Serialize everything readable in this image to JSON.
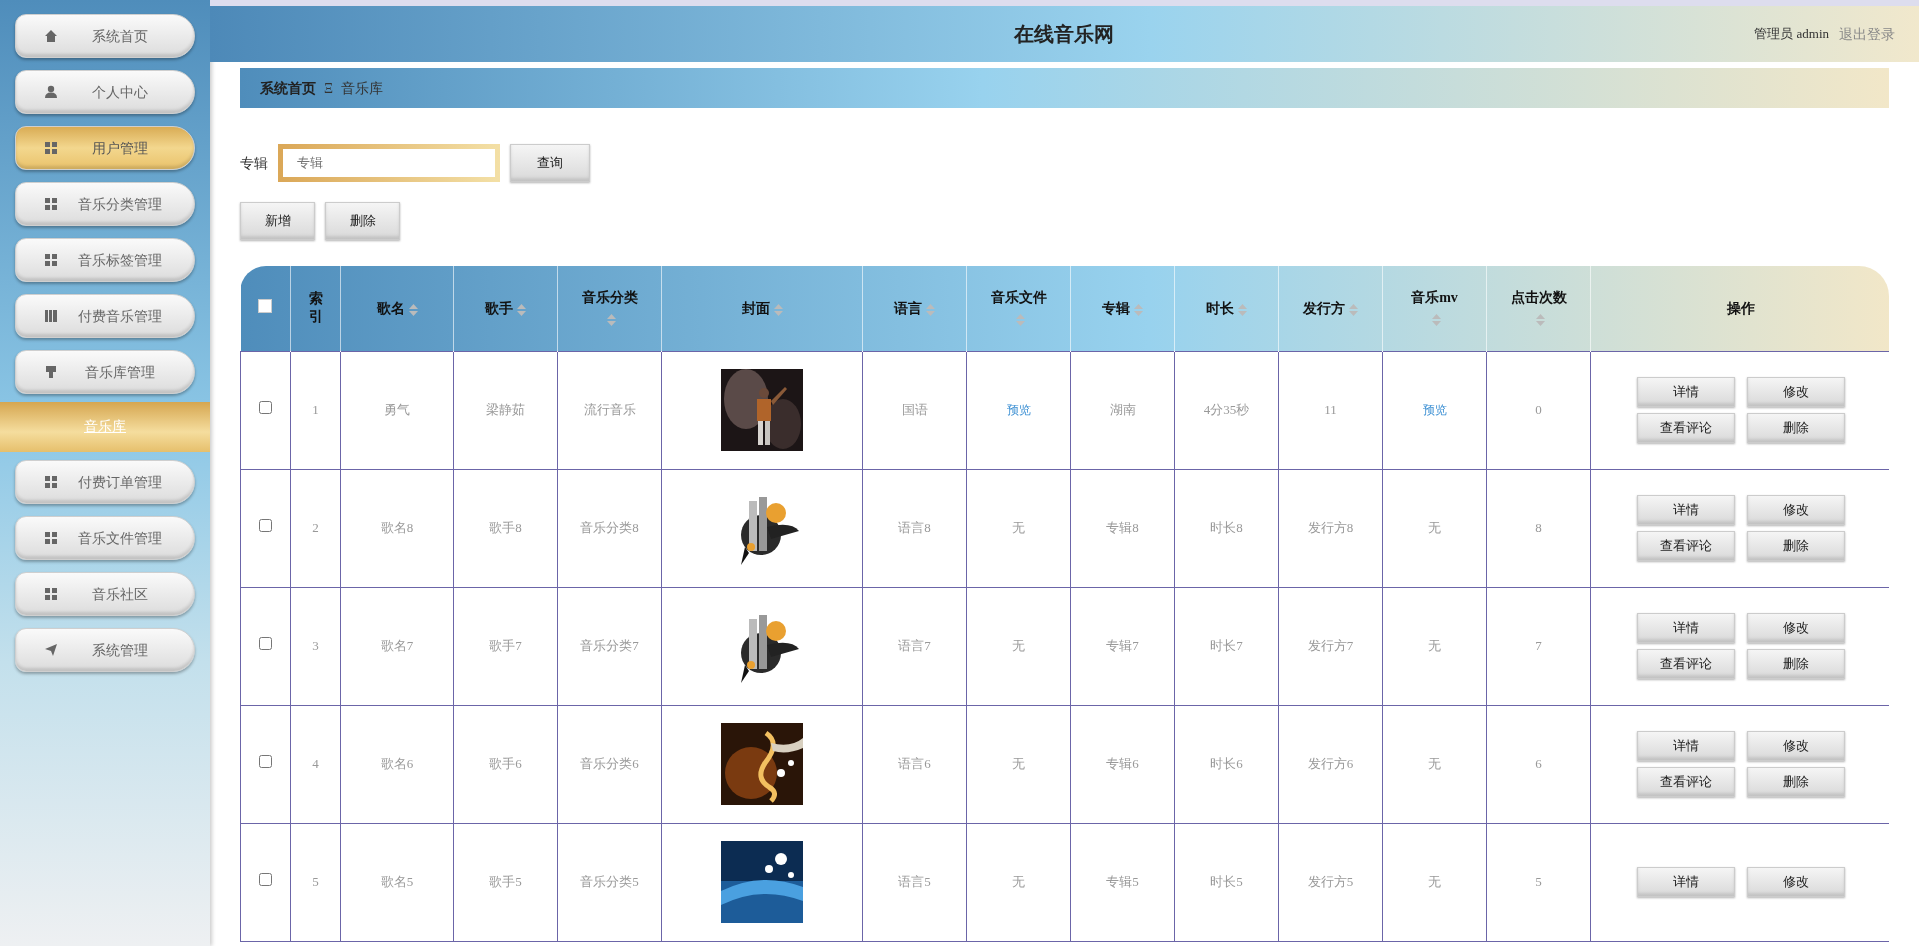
{
  "header": {
    "title": "在线音乐网",
    "user_label": "管理员 admin",
    "logout": "退出登录"
  },
  "sidebar": {
    "items": [
      {
        "label": "系统首页",
        "selected": false
      },
      {
        "label": "个人中心",
        "selected": false
      },
      {
        "label": "用户管理",
        "selected": true
      },
      {
        "label": "音乐分类管理",
        "selected": false
      },
      {
        "label": "音乐标签管理",
        "selected": false
      },
      {
        "label": "付费音乐管理",
        "selected": false
      },
      {
        "label": "音乐库管理",
        "selected": false,
        "children": [
          {
            "label": "音乐库",
            "selected": true
          }
        ]
      },
      {
        "label": "付费订单管理",
        "selected": false
      },
      {
        "label": "音乐文件管理",
        "selected": false
      },
      {
        "label": "音乐社区",
        "selected": false
      },
      {
        "label": "系统管理",
        "selected": false
      }
    ]
  },
  "breadcrumb": {
    "home": "系统首页",
    "separator": "Ξ",
    "current": "音乐库"
  },
  "search": {
    "label": "专辑",
    "placeholder": "专辑",
    "button": "查询"
  },
  "toolbar": [
    "新增",
    "删除"
  ],
  "table": {
    "header_checkbox": {
      "checked": false
    },
    "columns": [
      {
        "label": "索引",
        "sortable": false
      },
      {
        "label": "歌名",
        "sortable": true
      },
      {
        "label": "歌手",
        "sortable": true
      },
      {
        "label": "音乐分类",
        "sortable": true
      },
      {
        "label": "封面",
        "sortable": true
      },
      {
        "label": "语言",
        "sortable": true
      },
      {
        "label": "音乐文件",
        "sortable": true
      },
      {
        "label": "专辑",
        "sortable": true
      },
      {
        "label": "时长",
        "sortable": true
      },
      {
        "label": "发行方",
        "sortable": true
      },
      {
        "label": "音乐mv",
        "sortable": true
      },
      {
        "label": "点击次数",
        "sortable": true
      },
      {
        "label": "操作",
        "sortable": false
      }
    ],
    "rows": [
      {
        "checked": false,
        "cells": [
          {
            "kind": "text",
            "text": "1"
          },
          {
            "kind": "text",
            "text": "勇气"
          },
          {
            "kind": "text",
            "text": "梁静茹"
          },
          {
            "kind": "text",
            "text": "流行音乐"
          },
          {
            "kind": "picture"
          },
          {
            "kind": "text",
            "text": "国语"
          },
          {
            "kind": "link",
            "text": "预览"
          },
          {
            "kind": "text",
            "text": "湖南"
          },
          {
            "kind": "text",
            "text": "4分35秒"
          },
          {
            "kind": "text",
            "text": "11"
          },
          {
            "kind": "link",
            "text": "预览"
          },
          {
            "kind": "text",
            "text": "0"
          }
        ],
        "actions": [
          "详情",
          "修改",
          "查看评论",
          "删除"
        ]
      },
      {
        "checked": false,
        "cells": [
          {
            "kind": "text",
            "text": "2"
          },
          {
            "kind": "text",
            "text": "歌名8"
          },
          {
            "kind": "text",
            "text": "歌手8"
          },
          {
            "kind": "text",
            "text": "音乐分类8"
          },
          {
            "kind": "picture"
          },
          {
            "kind": "text",
            "text": "语言8"
          },
          {
            "kind": "text",
            "text": "无"
          },
          {
            "kind": "text",
            "text": "专辑8"
          },
          {
            "kind": "text",
            "text": "时长8"
          },
          {
            "kind": "text",
            "text": "发行方8"
          },
          {
            "kind": "text",
            "text": "无"
          },
          {
            "kind": "text",
            "text": "8"
          }
        ],
        "actions": [
          "详情",
          "修改",
          "查看评论",
          "删除"
        ]
      },
      {
        "checked": false,
        "cells": [
          {
            "kind": "text",
            "text": "3"
          },
          {
            "kind": "text",
            "text": "歌名7"
          },
          {
            "kind": "text",
            "text": "歌手7"
          },
          {
            "kind": "text",
            "text": "音乐分类7"
          },
          {
            "kind": "picture"
          },
          {
            "kind": "text",
            "text": "语言7"
          },
          {
            "kind": "text",
            "text": "无"
          },
          {
            "kind": "text",
            "text": "专辑7"
          },
          {
            "kind": "text",
            "text": "时长7"
          },
          {
            "kind": "text",
            "text": "发行方7"
          },
          {
            "kind": "text",
            "text": "无"
          },
          {
            "kind": "text",
            "text": "7"
          }
        ],
        "actions": [
          "详情",
          "修改",
          "查看评论",
          "删除"
        ]
      },
      {
        "checked": false,
        "cells": [
          {
            "kind": "text",
            "text": "4"
          },
          {
            "kind": "text",
            "text": "歌名6"
          },
          {
            "kind": "text",
            "text": "歌手6"
          },
          {
            "kind": "text",
            "text": "音乐分类6"
          },
          {
            "kind": "picture"
          },
          {
            "kind": "text",
            "text": "语言6"
          },
          {
            "kind": "text",
            "text": "无"
          },
          {
            "kind": "text",
            "text": "专辑6"
          },
          {
            "kind": "text",
            "text": "时长6"
          },
          {
            "kind": "text",
            "text": "发行方6"
          },
          {
            "kind": "text",
            "text": "无"
          },
          {
            "kind": "text",
            "text": "6"
          }
        ],
        "actions": [
          "详情",
          "修改",
          "查看评论",
          "删除"
        ]
      },
      {
        "checked": false,
        "cells": [
          {
            "kind": "text",
            "text": "5"
          },
          {
            "kind": "text",
            "text": "歌名5"
          },
          {
            "kind": "text",
            "text": "歌手5"
          },
          {
            "kind": "text",
            "text": "音乐分类5"
          },
          {
            "kind": "picture"
          },
          {
            "kind": "text",
            "text": "语言5"
          },
          {
            "kind": "text",
            "text": "无"
          },
          {
            "kind": "text",
            "text": "专辑5"
          },
          {
            "kind": "text",
            "text": "时长5"
          },
          {
            "kind": "text",
            "text": "发行方5"
          },
          {
            "kind": "text",
            "text": "无"
          },
          {
            "kind": "text",
            "text": "5"
          }
        ],
        "actions": [
          "详情",
          "修改"
        ]
      }
    ]
  }
}
